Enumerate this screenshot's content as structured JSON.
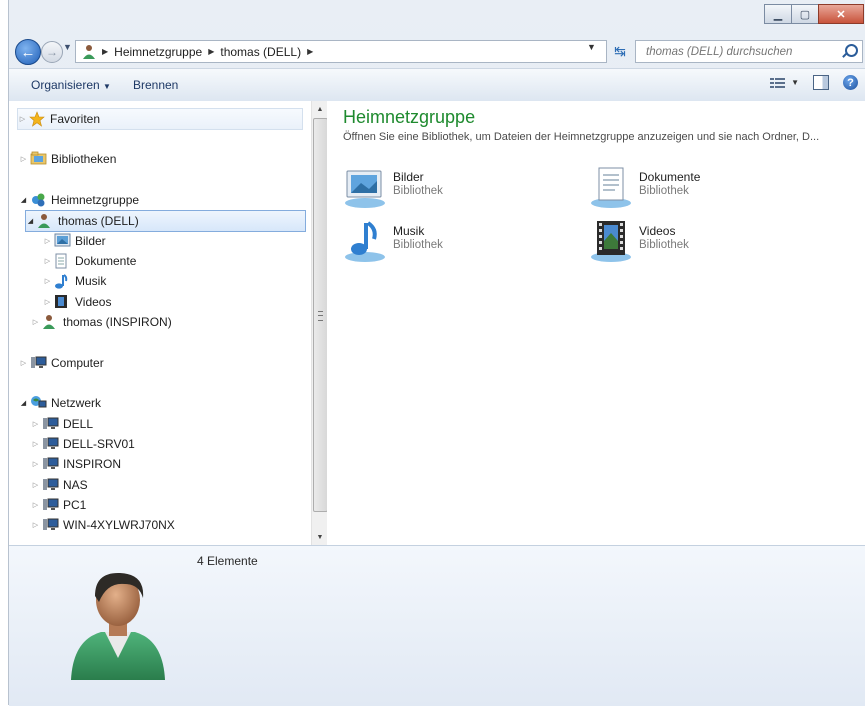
{
  "window": {
    "title_buttons": [
      "minimize",
      "maximize",
      "close"
    ]
  },
  "address": {
    "segments": [
      "Heimnetzgruppe",
      "thomas (DELL)"
    ],
    "search_placeholder": "thomas (DELL) durchsuchen"
  },
  "toolbar": {
    "organize": "Organisieren",
    "burn": "Brennen"
  },
  "nav": {
    "favorites": "Favoriten",
    "libraries": "Bibliotheken",
    "homegroup": "Heimnetzgruppe",
    "thomas_dell": "thomas (DELL)",
    "bilder": "Bilder",
    "dokumente": "Dokumente",
    "musik": "Musik",
    "videos": "Videos",
    "thomas_inspiron": "thomas (INSPIRON)",
    "computer": "Computer",
    "network": "Netzwerk",
    "net_items": [
      "DELL",
      "DELL-SRV01",
      "INSPIRON",
      "NAS",
      "PC1",
      "WIN-4XYLWRJ70NX"
    ]
  },
  "content": {
    "title": "Heimnetzgruppe",
    "description": "Öffnen Sie eine Bibliothek, um Dateien der Heimnetzgruppe anzuzeigen und sie nach Ordner, D...",
    "libraries": [
      {
        "name": "Bilder",
        "type": "Bibliothek"
      },
      {
        "name": "Dokumente",
        "type": "Bibliothek"
      },
      {
        "name": "Musik",
        "type": "Bibliothek"
      },
      {
        "name": "Videos",
        "type": "Bibliothek"
      }
    ]
  },
  "details": {
    "count": "4 Elemente"
  },
  "colors": {
    "title_green": "#1e8a2e",
    "selection": "#d7e7fa",
    "accent_blue": "#1f5fb8"
  }
}
